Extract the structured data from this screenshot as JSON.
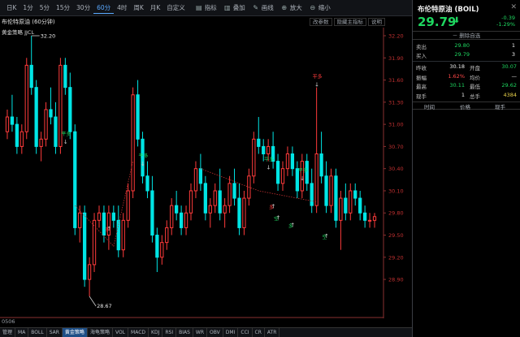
{
  "toolbar": {
    "periods": [
      "日K",
      "1分",
      "5分",
      "15分",
      "30分",
      "60分",
      "4时",
      "周K",
      "月K",
      "自定义"
    ],
    "active_period": 5,
    "buttons": [
      {
        "icon": "list-icon",
        "label": "指标"
      },
      {
        "icon": "overlay-icon",
        "label": "叠加"
      },
      {
        "icon": "drawing-icon",
        "label": "画线"
      },
      {
        "icon": "zoom-in-icon",
        "label": "放大"
      },
      {
        "icon": "zoom-out-icon",
        "label": "缩小"
      }
    ]
  },
  "chart": {
    "title": "布伦特原油 (60分钟)",
    "strategy": "黄金策略 JJCL",
    "right_buttons": [
      "改参数",
      "隐藏主指标",
      "说明"
    ],
    "time_label": "0506",
    "price_axis": [
      "32.20",
      "31.90",
      "31.60",
      "31.30",
      "31.00",
      "30.70",
      "30.40",
      "30.10",
      "29.80",
      "29.50",
      "29.20",
      "28.90"
    ],
    "high_label": "32.20",
    "low_label": "28.67",
    "signals": [
      "平多",
      "多",
      "平多",
      "平多",
      "多",
      "平多",
      "平多",
      "多",
      "空",
      "空"
    ]
  },
  "chart_data": {
    "type": "candlestick",
    "ylim": [
      28.67,
      32.2
    ],
    "candles": [
      [
        30.9,
        31.2,
        30.8,
        31.1
      ],
      [
        31.1,
        31.4,
        30.9,
        31.0
      ],
      [
        31.0,
        31.1,
        30.6,
        30.7
      ],
      [
        30.7,
        31.0,
        30.6,
        30.9
      ],
      [
        30.9,
        31.9,
        30.8,
        31.8
      ],
      [
        31.8,
        32.2,
        31.4,
        31.5
      ],
      [
        31.5,
        31.6,
        30.6,
        30.7
      ],
      [
        30.7,
        30.9,
        30.5,
        30.8
      ],
      [
        30.8,
        31.3,
        30.7,
        31.2
      ],
      [
        31.2,
        31.5,
        31.0,
        31.1
      ],
      [
        31.1,
        31.3,
        30.6,
        30.7
      ],
      [
        30.7,
        31.9,
        30.6,
        31.8
      ],
      [
        31.8,
        31.9,
        31.4,
        31.5
      ],
      [
        31.5,
        31.7,
        30.8,
        30.9
      ],
      [
        30.9,
        31.0,
        29.5,
        29.6
      ],
      [
        29.6,
        29.9,
        29.4,
        29.8
      ],
      [
        29.8,
        29.9,
        28.8,
        28.9
      ],
      [
        28.9,
        29.2,
        28.67,
        29.1
      ],
      [
        29.1,
        29.8,
        29.0,
        29.7
      ],
      [
        29.7,
        29.9,
        29.6,
        29.8
      ],
      [
        29.8,
        29.9,
        29.4,
        29.5
      ],
      [
        29.5,
        29.9,
        29.3,
        29.8
      ],
      [
        29.8,
        29.9,
        29.6,
        29.7
      ],
      [
        29.7,
        29.9,
        29.2,
        29.3
      ],
      [
        29.3,
        29.8,
        29.2,
        29.7
      ],
      [
        29.7,
        30.2,
        29.6,
        30.1
      ],
      [
        30.1,
        31.5,
        30.0,
        31.4
      ],
      [
        31.4,
        31.6,
        30.7,
        30.8
      ],
      [
        30.8,
        30.9,
        30.2,
        30.3
      ],
      [
        30.3,
        30.5,
        30.0,
        30.1
      ],
      [
        30.1,
        30.3,
        29.4,
        29.5
      ],
      [
        29.5,
        29.6,
        29.0,
        29.2
      ],
      [
        29.2,
        29.5,
        29.1,
        29.4
      ],
      [
        29.4,
        29.7,
        29.3,
        29.6
      ],
      [
        29.6,
        30.0,
        29.5,
        29.9
      ],
      [
        29.9,
        30.1,
        29.7,
        29.8
      ],
      [
        29.8,
        29.9,
        29.5,
        29.6
      ],
      [
        29.6,
        29.9,
        29.5,
        29.8
      ],
      [
        29.8,
        30.2,
        29.7,
        30.1
      ],
      [
        30.1,
        30.5,
        30.0,
        30.4
      ],
      [
        30.4,
        30.6,
        30.1,
        30.2
      ],
      [
        30.2,
        30.3,
        29.7,
        29.8
      ],
      [
        29.8,
        30.0,
        29.6,
        29.9
      ],
      [
        29.9,
        30.2,
        29.8,
        30.1
      ],
      [
        30.1,
        30.4,
        29.7,
        29.8
      ],
      [
        29.8,
        30.0,
        29.6,
        29.9
      ],
      [
        29.9,
        30.3,
        29.8,
        30.2
      ],
      [
        30.2,
        30.4,
        29.9,
        30.0
      ],
      [
        30.0,
        30.2,
        29.5,
        29.6
      ],
      [
        29.6,
        30.1,
        29.5,
        30.0
      ],
      [
        30.0,
        30.4,
        29.9,
        30.3
      ],
      [
        30.3,
        30.9,
        30.2,
        30.8
      ],
      [
        30.8,
        31.1,
        30.6,
        30.7
      ],
      [
        30.7,
        30.8,
        30.5,
        30.6
      ],
      [
        30.6,
        30.8,
        30.5,
        30.7
      ],
      [
        30.7,
        30.9,
        30.4,
        30.5
      ],
      [
        30.5,
        30.6,
        30.1,
        30.2
      ],
      [
        30.2,
        30.5,
        30.1,
        30.4
      ],
      [
        30.4,
        30.7,
        30.3,
        30.6
      ],
      [
        30.6,
        30.7,
        30.3,
        30.4
      ],
      [
        30.4,
        30.5,
        30.0,
        30.1
      ],
      [
        30.1,
        30.6,
        30.0,
        30.5
      ],
      [
        30.5,
        30.6,
        30.1,
        30.2
      ],
      [
        30.2,
        30.4,
        29.8,
        29.9
      ],
      [
        29.9,
        31.5,
        29.8,
        30.6
      ],
      [
        30.6,
        30.9,
        30.2,
        30.3
      ],
      [
        30.3,
        30.5,
        29.8,
        29.9
      ],
      [
        29.9,
        30.4,
        29.8,
        30.3
      ],
      [
        30.3,
        30.4,
        29.6,
        29.7
      ],
      [
        29.7,
        30.1,
        29.3,
        30.0
      ],
      [
        30.0,
        30.2,
        29.7,
        29.8
      ],
      [
        29.8,
        30.2,
        29.7,
        30.1
      ],
      [
        30.1,
        30.2,
        29.9,
        30.0
      ],
      [
        30.0,
        30.1,
        29.7,
        29.8
      ],
      [
        29.8,
        29.9,
        29.6,
        29.7
      ],
      [
        29.7,
        29.8,
        29.6,
        29.7
      ],
      [
        29.7,
        29.8,
        29.6,
        29.75
      ]
    ]
  },
  "indicators": [
    "管理",
    "MA",
    "BOLL",
    "SAR",
    "黄金策略",
    "海龟策略",
    "VOL",
    "MACD",
    "KDJ",
    "RSI",
    "BIAS",
    "WR",
    "OBV",
    "DMI",
    "CCI",
    "CR",
    "ATR"
  ],
  "active_indicator": 4,
  "quote": {
    "name": "布伦特原油 (BOIL)",
    "price": "29.79",
    "arrow": "⬇",
    "change": "-0.39",
    "change_pct": "-1.29%",
    "fav_label": "－ 删除自选",
    "orderbook": [
      {
        "label": "卖出",
        "price": "29.80",
        "qty": "1"
      },
      {
        "label": "买入",
        "price": "29.79",
        "qty": "3"
      }
    ],
    "stats": [
      {
        "l1": "昨收",
        "v1": "30.18",
        "c1": "white",
        "l2": "开盘",
        "v2": "30.07",
        "c2": "green"
      },
      {
        "l1": "振幅",
        "v1": "1.62%",
        "c1": "red",
        "l2": "均价",
        "v2": "—",
        "c2": "white"
      },
      {
        "l1": "最高",
        "v1": "30.11",
        "c1": "green",
        "l2": "最低",
        "v2": "29.62",
        "c2": "green"
      },
      {
        "l1": "现手",
        "v1": "1",
        "c1": "white",
        "l2": "总手",
        "v2": "4384",
        "c2": "yellow"
      }
    ],
    "columns": [
      "时间",
      "价格",
      "现手"
    ]
  },
  "colors": {
    "up": "#ff3b3b",
    "down": "#00e5e5",
    "accent": "#5aa9ff"
  }
}
